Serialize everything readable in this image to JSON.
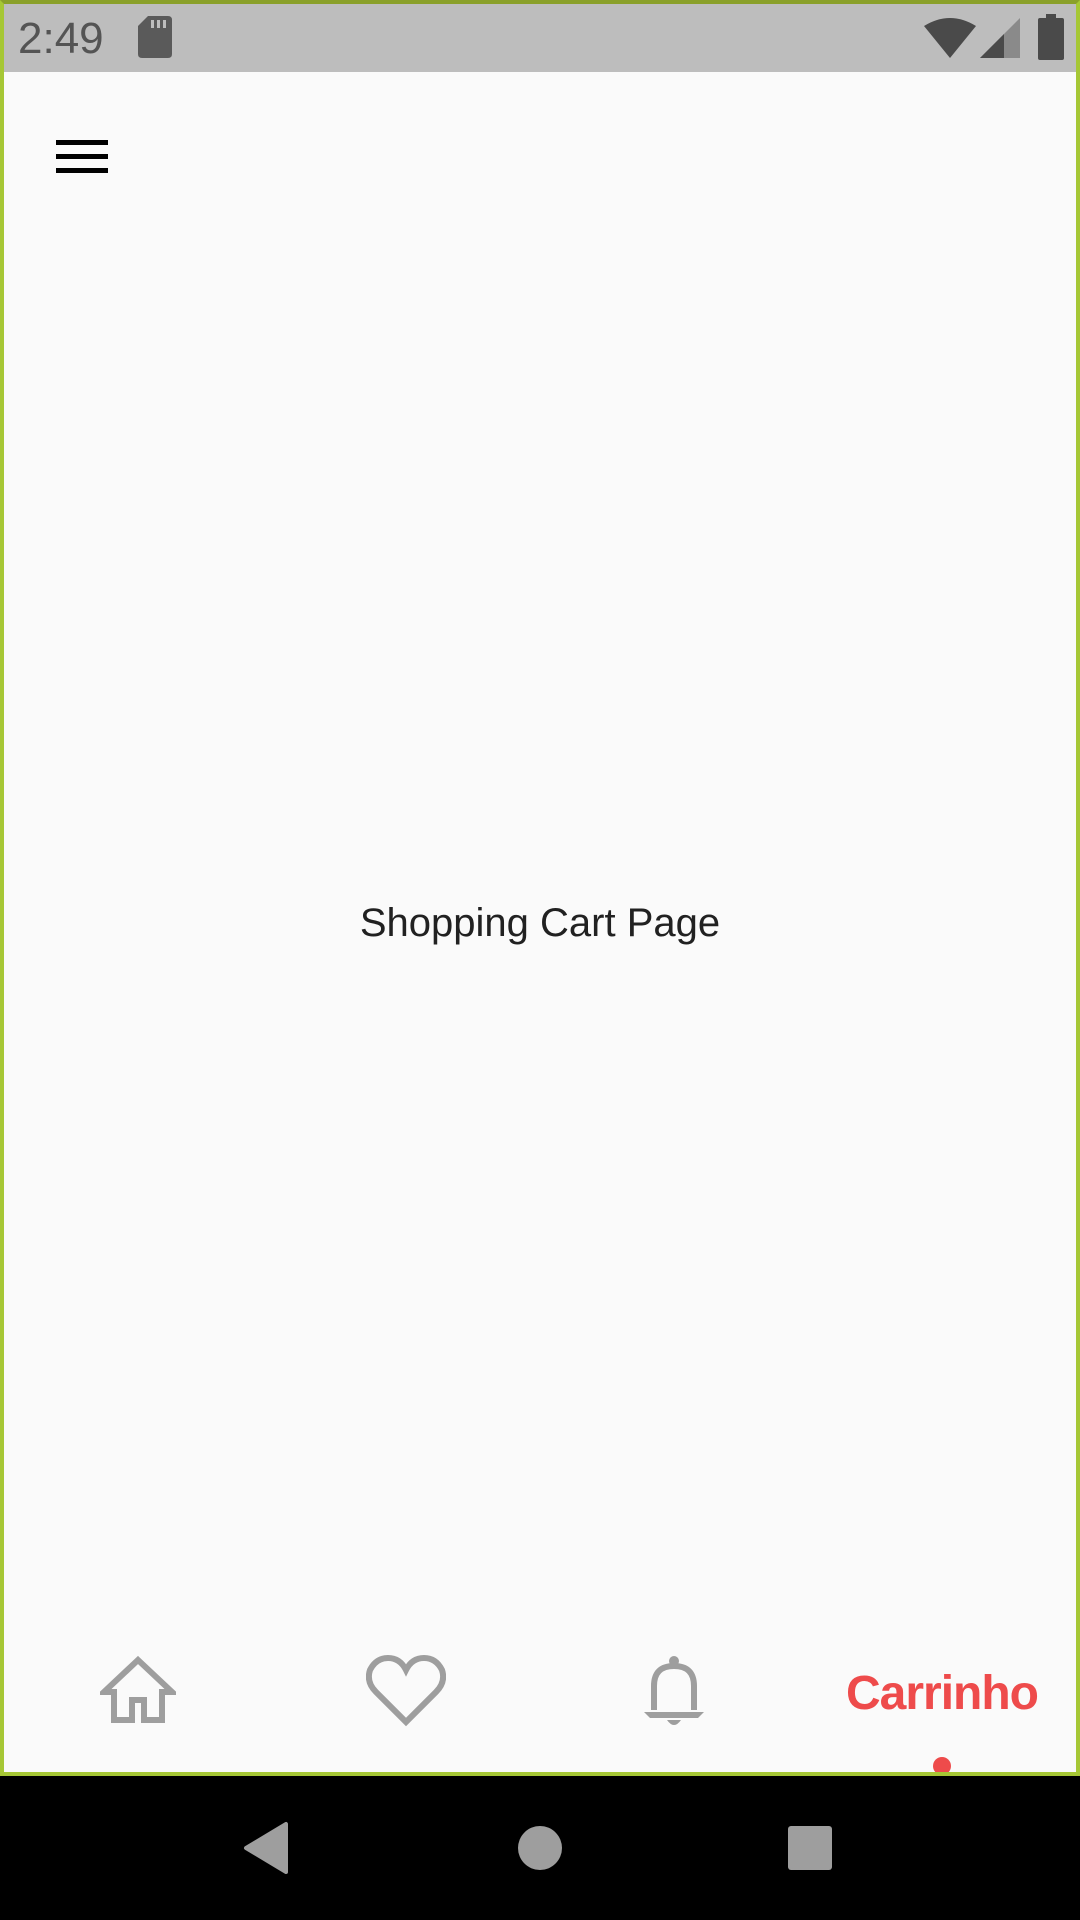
{
  "status_bar": {
    "time": "2:49",
    "icons": [
      "sd-card-icon",
      "wifi-icon",
      "cellular-signal-icon",
      "battery-icon"
    ]
  },
  "app_bar": {
    "menu_icon": "hamburger-menu-icon"
  },
  "main": {
    "page_text": "Shopping Cart Page"
  },
  "bottom_nav": {
    "items": [
      {
        "icon": "home-icon",
        "label": "",
        "active": false
      },
      {
        "icon": "heart-icon",
        "label": "",
        "active": false
      },
      {
        "icon": "bell-icon",
        "label": "",
        "active": false
      },
      {
        "icon": "",
        "label": "Carrinho",
        "active": true
      }
    ],
    "active_color": "#ee4b4b",
    "inactive_color": "#9e9e9e"
  },
  "system_nav": {
    "buttons": [
      "back-icon",
      "home-circle-icon",
      "recents-icon"
    ]
  },
  "colors": {
    "background": "#fafafa",
    "status_bar": "#bdbdbd",
    "frame_border": "#a6c735",
    "text": "#212121"
  }
}
